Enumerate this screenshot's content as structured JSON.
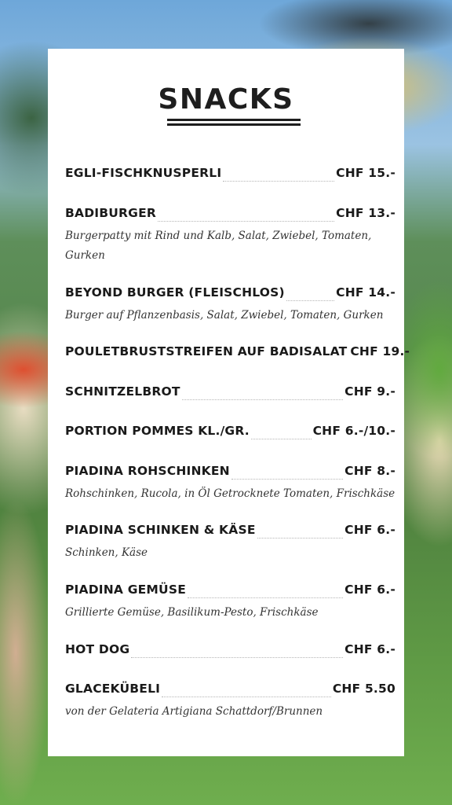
{
  "menu": {
    "title": "SNACKS",
    "items": [
      {
        "name": "EGLI-FISCHKNUSPERLI",
        "price": "CHF 15.-",
        "description": ""
      },
      {
        "name": "BADIBURGER",
        "price": "CHF 13.-",
        "description": "Burgerpatty mit Rind und Kalb, Salat, Zwiebel, Tomaten, Gurken"
      },
      {
        "name": "BEYOND BURGER (FLEISCHLOS)",
        "price": "CHF 14.-",
        "description": "Burger auf Pflanzenbasis, Salat, Zwiebel, Tomaten, Gurken"
      },
      {
        "name": "POULETBRUSTSTREIFEN AUF BADISALAT",
        "price": "CHF 19.-",
        "description": ""
      },
      {
        "name": "SCHNITZELBROT",
        "price": "CHF 9.-",
        "description": ""
      },
      {
        "name": "PORTION POMMES KL./GR.",
        "price": "CHF 6.-/10.-",
        "description": ""
      },
      {
        "name": "PIADINA ROHSCHINKEN",
        "price": "CHF 8.-",
        "description": "Rohschinken, Rucola, in Öl Getrocknete Tomaten, Frischkäse"
      },
      {
        "name": "PIADINA SCHINKEN & KÄSE",
        "price": "CHF 6.-",
        "description": "Schinken, Käse"
      },
      {
        "name": "PIADINA GEMÜSE",
        "price": "CHF 6.-",
        "description": "Grillierte Gemüse, Basilikum-Pesto, Frischkäse"
      },
      {
        "name": "HOT DOG",
        "price": "CHF 6.-",
        "description": ""
      },
      {
        "name": "GLACEKÜBELI",
        "price": "CHF 5.50",
        "description": "von der Gelateria Artigiana Schattdorf/Brunnen"
      }
    ]
  }
}
